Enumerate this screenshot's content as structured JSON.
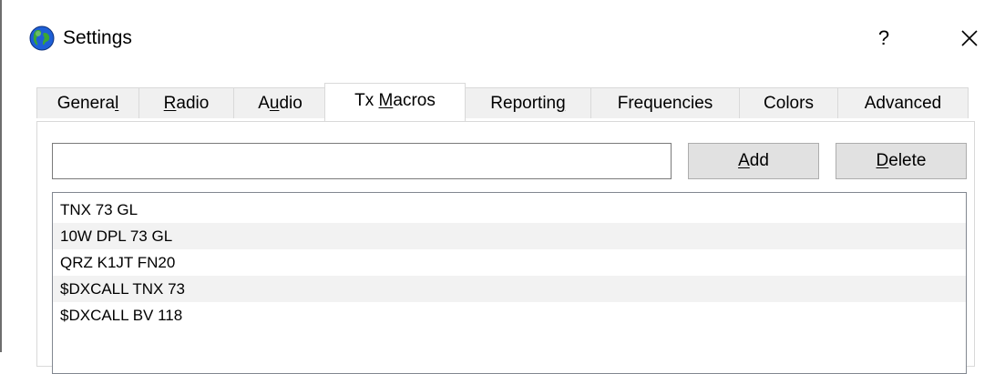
{
  "window": {
    "title": "Settings",
    "help_label": "?",
    "icon": "globe-icon",
    "close_icon": "close-icon"
  },
  "tabs": [
    {
      "pre": "Genera",
      "u": "l",
      "post": "",
      "active": false
    },
    {
      "pre": "",
      "u": "R",
      "post": "adio",
      "active": false
    },
    {
      "pre": "A",
      "u": "u",
      "post": "dio",
      "active": false
    },
    {
      "pre": "Tx ",
      "u": "M",
      "post": "acros",
      "active": true
    },
    {
      "pre": "Reportin",
      "u": "g",
      "post": "",
      "active": false
    },
    {
      "pre": "Frequencies",
      "u": "",
      "post": "",
      "active": false
    },
    {
      "pre": "Colors",
      "u": "",
      "post": "",
      "active": false
    },
    {
      "pre": "Advanced",
      "u": "",
      "post": "",
      "active": false
    }
  ],
  "macro_input": {
    "value": "",
    "placeholder": ""
  },
  "buttons": {
    "add": {
      "pre": "",
      "u": "A",
      "post": "dd"
    },
    "delete": {
      "pre": "",
      "u": "D",
      "post": "elete"
    }
  },
  "macros": [
    "TNX 73 GL",
    "10W DPL 73 GL",
    "QRZ K1JT FN20",
    "$DXCALL TNX 73",
    "$DXCALL BV 118"
  ],
  "colors": {
    "tab_bg": "#f0f0f0",
    "active_tab_bg": "#ffffff",
    "button_bg": "#e1e1e1",
    "alt_row_bg": "#f2f2f2"
  }
}
